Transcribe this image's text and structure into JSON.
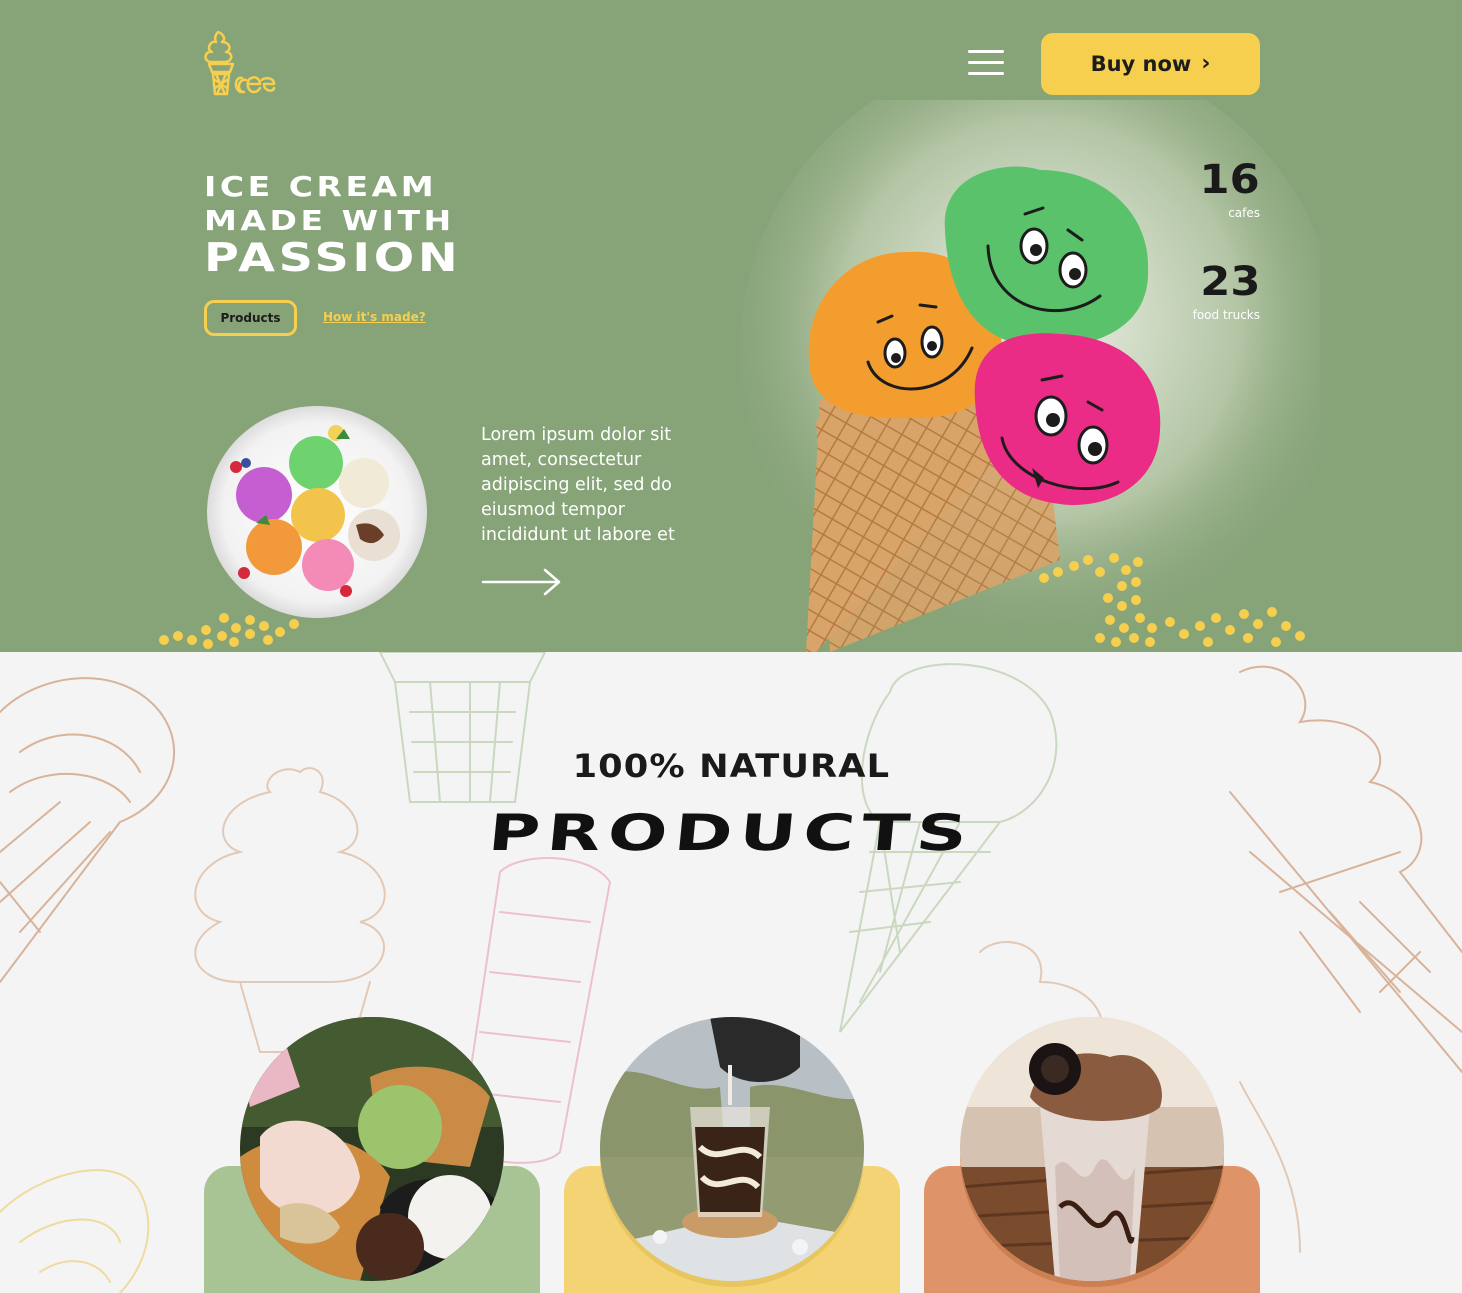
{
  "header": {
    "logo_icon": "ice-cream-logo-icon",
    "menu_icon": "hamburger-menu-icon",
    "buy_button_label": "Buy now",
    "buy_button_icon": "chevron-right-icon"
  },
  "hero": {
    "title_line1": "ICE CREAM",
    "title_line2": "MADE WITH",
    "title_line3": "PASSION",
    "products_button_label": "Products",
    "how_link_label": "How it's made?",
    "description": "Lorem ipsum dolor sit amet, consectetur adipiscing elit, sed do eiusmod tempor incididunt ut labore et",
    "arrow_icon": "arrow-right-icon",
    "stats": [
      {
        "value": "16",
        "label": "cafes"
      },
      {
        "value": "23",
        "label": "food trucks"
      }
    ]
  },
  "products_section": {
    "subtitle": "100% NATURAL",
    "title": "PRODUCTS",
    "cards": [
      {
        "name": "waffle-cone-ice-cream",
        "color": "#a8c495"
      },
      {
        "name": "iced-coffee",
        "color": "#f3d374"
      },
      {
        "name": "oreo-milkshake",
        "color": "#de9468"
      }
    ]
  },
  "colors": {
    "hero_bg": "#87a378",
    "accent_yellow": "#f7cf4e",
    "section_bg": "#f4f4f4"
  }
}
